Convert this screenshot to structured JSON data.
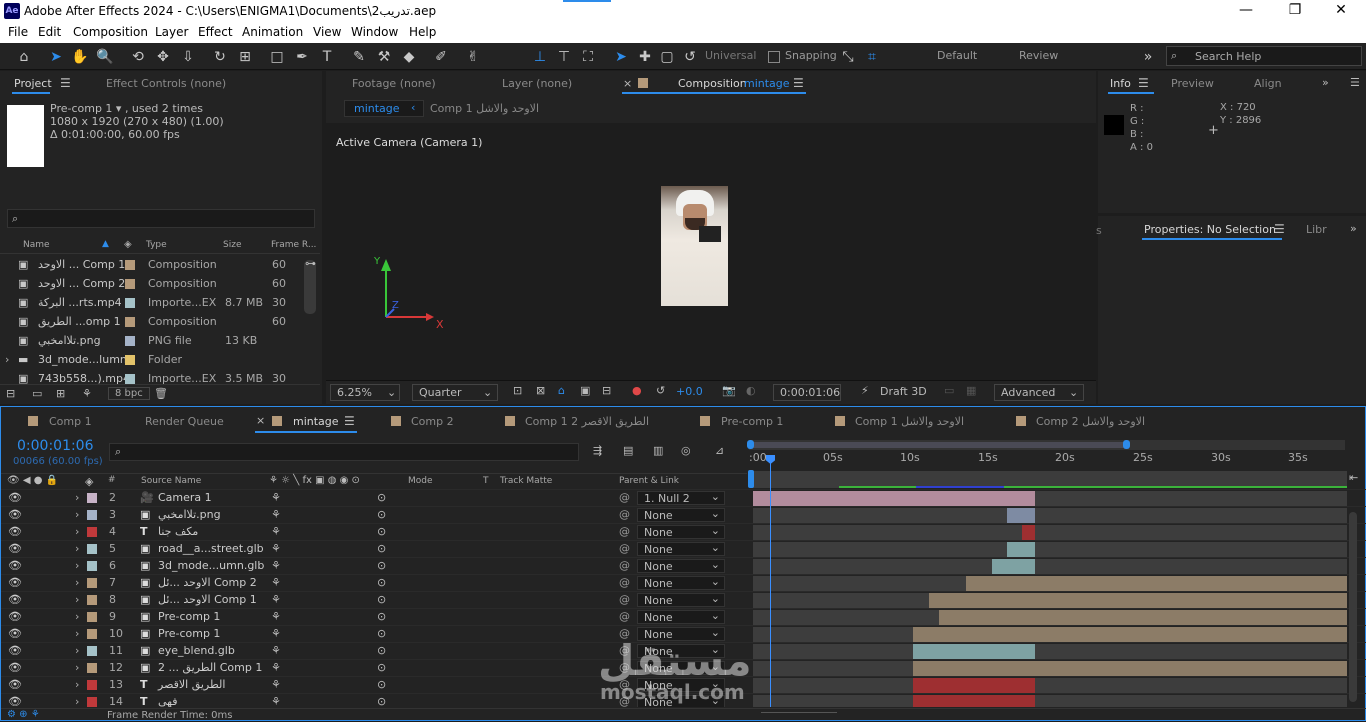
{
  "app": {
    "title": "Adobe After Effects 2024 - C:\\Users\\ENIGMA1\\Documents\\تدريب2.aep",
    "icon": "Ae"
  },
  "window_controls": {
    "minimize": "—",
    "maximize": "❐",
    "close": "✕"
  },
  "menu": [
    "File",
    "Edit",
    "Composition",
    "Layer",
    "Effect",
    "Animation",
    "View",
    "Window",
    "Help"
  ],
  "toolbar": {
    "universal": "Universal",
    "snapping": "Snapping",
    "workspaces": [
      "Default",
      "Review"
    ],
    "search_placeholder": "Search Help"
  },
  "project": {
    "tab": "Project",
    "effect_controls": "Effect Controls (none)",
    "item_name": "Pre-comp 1 ▾ , used 2 times",
    "item_dims": "1080 x 1920  (270 x 480) (1.00)",
    "item_dur": "Δ 0:01:00:00, 60.00 fps",
    "search_placeholder": "",
    "columns": {
      "name": "Name",
      "type": "Type",
      "size": "Size",
      "frame": "Frame R..."
    },
    "items": [
      {
        "name": "الاوحد ... Comp 1",
        "type": "Composition",
        "size": "",
        "frame": "60",
        "color": "#b59a7a"
      },
      {
        "name": "الاوحد ... Comp 2",
        "type": "Composition",
        "size": "",
        "frame": "60",
        "color": "#b59a7a"
      },
      {
        "name": "البركة ...rts.mp4",
        "type": "Importe...EX",
        "size": "8.7 MB",
        "frame": "30",
        "color": "#a5c2c8"
      },
      {
        "name": "الطريق ...omp 1",
        "type": "Composition",
        "size": "",
        "frame": "60",
        "color": "#b59a7a"
      },
      {
        "name": "تلاامخبي.png",
        "type": "PNG file",
        "size": "13 KB",
        "frame": "",
        "color": "#a5b3c8"
      },
      {
        "name": "3d_mode...lumn",
        "type": "Folder",
        "size": "",
        "frame": "",
        "color": "#e3c36a"
      },
      {
        "name": "743b558...).mp4",
        "type": "Importe...EX",
        "size": "3.5 MB",
        "frame": "30",
        "color": "#a5c2c8"
      }
    ],
    "bpc": "8 bpc"
  },
  "viewer_tabs": {
    "footage": "Footage (none)",
    "layer": "Layer (none)",
    "composition": "Composition",
    "comp_name": "mintage",
    "breadcrumb_active": "mintage",
    "breadcrumb_other": "Comp 1 الاوحد والاشل"
  },
  "viewer": {
    "camera_label": "Active Camera (Camera 1)",
    "axis_y": "Y",
    "axis_x": "X",
    "axis_z": "Z",
    "zoom": "6.25%",
    "quality": "Quarter",
    "exposure": "+0.0",
    "timecode": "0:00:01:06",
    "renderer": "Draft 3D",
    "advanced": "Advanced"
  },
  "info": {
    "tab": "Info",
    "preview": "Preview",
    "align": "Align",
    "r": "R :",
    "g": "G :",
    "b": "B :",
    "a": "A :  0",
    "x": "X : 720",
    "y": "Y : 2896",
    "properties": "Properties: No Selection",
    "libr": "Libr"
  },
  "timeline": {
    "tabs": [
      "Comp 1",
      "Render Queue",
      "mintage",
      "Comp 2",
      "Comp 1 2 الطريق الاقصر",
      "Pre-comp 1",
      "Comp 1 الاوحد والاشل",
      "Comp 2 الاوحد والاشل"
    ],
    "timecode": "0:00:01:06",
    "frames": "00066 (60.00 fps)",
    "headers": {
      "num": "#",
      "source": "Source Name",
      "mode": "Mode",
      "t": "T",
      "matte": "Track Matte",
      "parent": "Parent & Link"
    },
    "ruler": [
      ":00s",
      "05s",
      "10s",
      "15s",
      "20s",
      "25s",
      "30s",
      "35s"
    ],
    "layers": [
      {
        "num": "2",
        "name": "Camera 1",
        "icon": "🎥",
        "label": "#c7b3c7",
        "parent": "1. Null 2",
        "bar_start": 0.0,
        "bar_end": 0.475,
        "bar_color": "#b28c9d"
      },
      {
        "num": "3",
        "name": "تلاامخبي.png",
        "icon": "▣",
        "label": "#a5b3c8",
        "parent": "None",
        "bar_start": 0.428,
        "bar_end": 0.475,
        "bar_color": "#7e8ba3"
      },
      {
        "num": "4",
        "name": "مكف جنا",
        "icon": "T",
        "label": "#c0393b",
        "parent": "None",
        "bar_start": 0.453,
        "bar_end": 0.475,
        "bar_color": "#9e2f31"
      },
      {
        "num": "5",
        "name": "road__a...street.glb",
        "icon": "▣",
        "label": "#a5c2c8",
        "parent": "None",
        "bar_start": 0.428,
        "bar_end": 0.475,
        "bar_color": "#7ea2a3"
      },
      {
        "num": "6",
        "name": "3d_mode...umn.glb",
        "icon": "▣",
        "label": "#a5c2c8",
        "parent": "None",
        "bar_start": 0.403,
        "bar_end": 0.475,
        "bar_color": "#7ea2a3"
      },
      {
        "num": "7",
        "name": "الاوحد ...ئل Comp 2",
        "icon": "▣",
        "label": "#b59a7a",
        "parent": "None",
        "bar_start": 0.358,
        "bar_end": 1.0,
        "bar_color": "#8c7c67"
      },
      {
        "num": "8",
        "name": "الاوحد ...ئل Comp 1",
        "icon": "▣",
        "label": "#b59a7a",
        "parent": "None",
        "bar_start": 0.297,
        "bar_end": 1.0,
        "bar_color": "#8c7c67"
      },
      {
        "num": "9",
        "name": "Pre-comp 1",
        "icon": "▣",
        "label": "#b59a7a",
        "parent": "None",
        "bar_start": 0.313,
        "bar_end": 1.0,
        "bar_color": "#8c7c67"
      },
      {
        "num": "10",
        "name": "Pre-comp 1",
        "icon": "▣",
        "label": "#b59a7a",
        "parent": "None",
        "bar_start": 0.27,
        "bar_end": 1.0,
        "bar_color": "#8c7c67"
      },
      {
        "num": "11",
        "name": "eye_blend.glb",
        "icon": "▣",
        "label": "#a5c2c8",
        "parent": "None",
        "bar_start": 0.27,
        "bar_end": 0.475,
        "bar_color": "#7ea2a3"
      },
      {
        "num": "12",
        "name": "2 ... الطريق Comp 1",
        "icon": "▣",
        "label": "#b59a7a",
        "parent": "None",
        "bar_start": 0.27,
        "bar_end": 1.0,
        "bar_color": "#8c7c67"
      },
      {
        "num": "13",
        "name": "الطريق الاقصر",
        "icon": "T",
        "label": "#c0393b",
        "parent": "None",
        "bar_start": 0.27,
        "bar_end": 0.475,
        "bar_color": "#9e2f31"
      },
      {
        "num": "14",
        "name": "فهي",
        "icon": "T",
        "label": "#c0393b",
        "parent": "None",
        "bar_start": 0.27,
        "bar_end": 0.475,
        "bar_color": "#9e2f31"
      }
    ],
    "footer": "Frame Render Time:  0ms"
  },
  "watermark": {
    "text": "مستقل",
    "sub": "mostaql.com"
  },
  "colors": {
    "accent": "#2d8ceb",
    "playhead": "#3a8fff"
  }
}
